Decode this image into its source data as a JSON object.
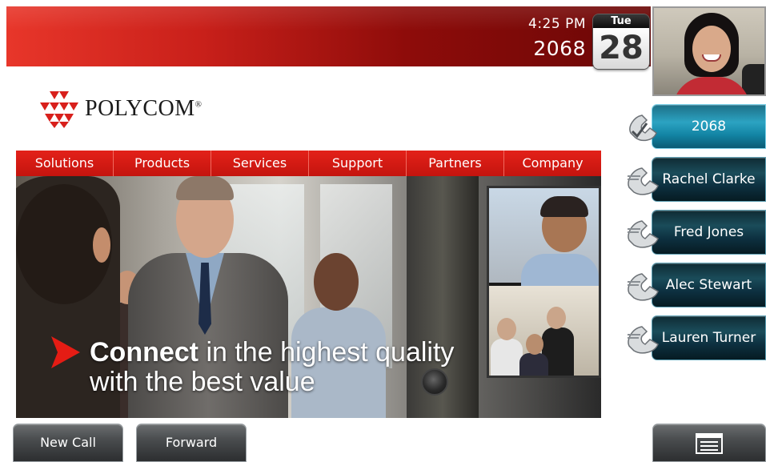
{
  "status_bar": {
    "time": "4:25 PM",
    "line_number": "2068",
    "calendar": {
      "day": "Tue",
      "date": "28"
    }
  },
  "logo": {
    "text": "POLYCOM",
    "mark": "®"
  },
  "web": {
    "nav": [
      "Solutions",
      "Products",
      "Services",
      "Support",
      "Partners",
      "Company"
    ],
    "hero": {
      "headline_bold": "Connect",
      "headline_rest": " in the highest quality",
      "headline_line2": "with the best value"
    }
  },
  "line_keys": [
    {
      "label": "2068",
      "active": true
    },
    {
      "label": "Rachel Clarke",
      "active": false
    },
    {
      "label": "Fred Jones",
      "active": false
    },
    {
      "label": "Alec Stewart",
      "active": false
    },
    {
      "label": "Lauren Turner",
      "active": false
    }
  ],
  "softkeys": {
    "new_call": "New Call",
    "forward": "Forward",
    "menu_icon": "menu-list-icon"
  },
  "colors": {
    "accent_red": "#c4140e",
    "line_key_teal": "#1a4c5a",
    "line_key_active": "#2ca3c2"
  }
}
